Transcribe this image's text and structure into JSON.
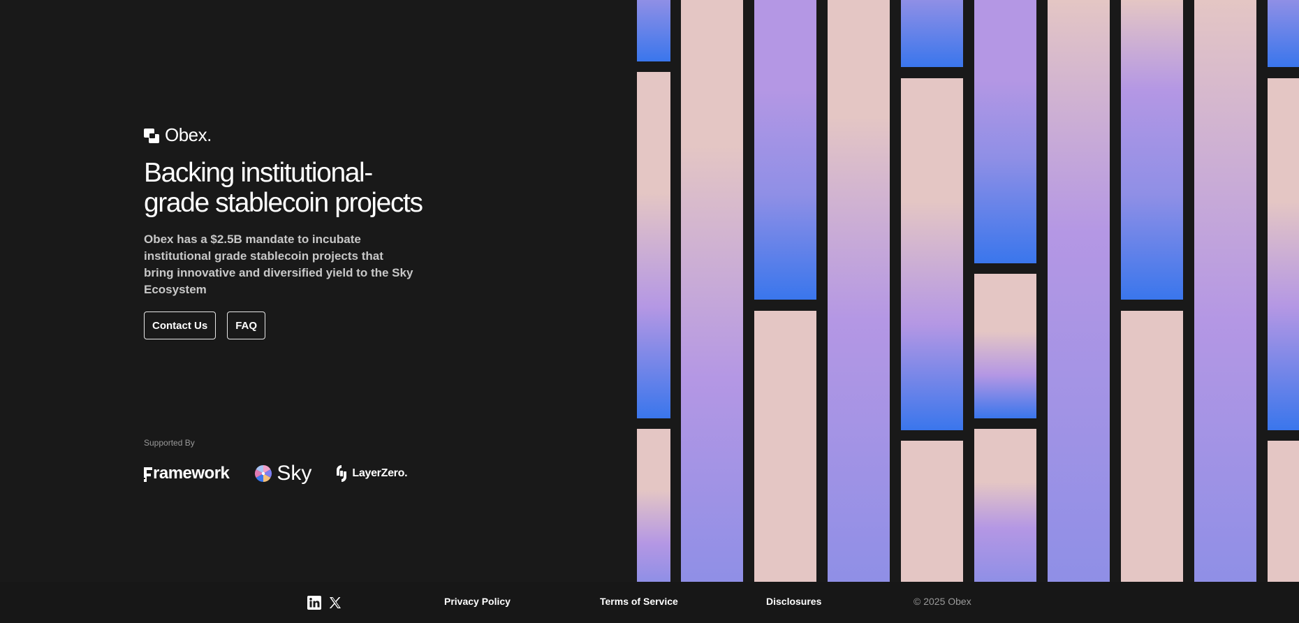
{
  "brand": {
    "name": "Obex.",
    "logo_icon": "obex-logo-icon"
  },
  "hero": {
    "headline_lines": [
      "Backing institutional-",
      "grade stablecoin projects"
    ],
    "lead_lines": [
      "Obex has a $2.5B mandate to incubate",
      "institutional grade stablecoin projects that",
      "bring innovative and diversified yield to the Sky",
      "Ecosystem"
    ],
    "buttons": {
      "contact": "Contact Us",
      "faq": "FAQ"
    }
  },
  "supported": {
    "label": "Supported By",
    "partners": {
      "framework": "ramework",
      "sky": "Sky",
      "layerzero": "LayerZero."
    }
  },
  "footer": {
    "social": [
      "linkedin-icon",
      "x-icon"
    ],
    "links": {
      "privacy": "Privacy Policy",
      "terms": "Terms of Service",
      "disclosures": "Disclosures"
    },
    "copyright": "© 2025 Obex"
  },
  "colors": {
    "background": "#191919",
    "pink": "#e4c6c4",
    "lavender": "#b497e4",
    "periwinkle": "#8f8fe6",
    "blue": "#3a76ec"
  }
}
